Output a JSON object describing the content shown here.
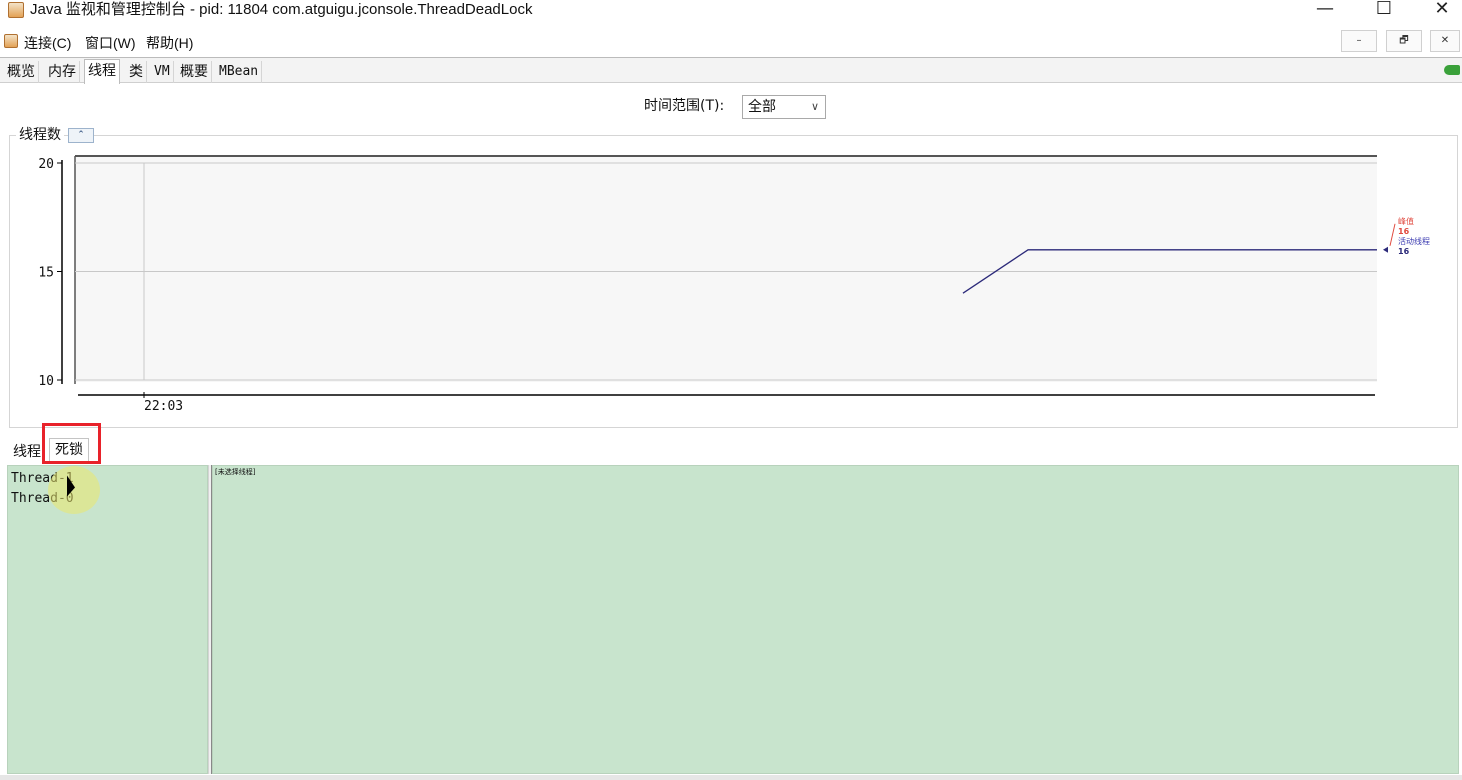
{
  "window": {
    "title": "Java 监视和管理控制台 - pid: 11804 com.atguigu.jconsole.ThreadDeadLock",
    "minimize_glyph": "—",
    "maximize_glyph": "☐",
    "close_glyph": "✕"
  },
  "menu": {
    "items": [
      "连接(C)",
      "窗口(W)",
      "帮助(H)"
    ],
    "inner_buttons": [
      "–",
      "🗗",
      "✕"
    ]
  },
  "main_tabs": {
    "items": [
      "概览",
      "内存",
      "线程",
      "类",
      "VM",
      "概要",
      "MBean"
    ],
    "active": "线程"
  },
  "time_range": {
    "label": "时间范围(T):",
    "value": "全部",
    "caret": "∨"
  },
  "panel": {
    "title": "线程数",
    "collapse_glyph": "⌃"
  },
  "chart_data": {
    "type": "line",
    "title": "",
    "xlabel": "",
    "ylabel": "",
    "ylim": [
      10,
      20
    ],
    "yticks": [
      10,
      15,
      20
    ],
    "xticks": [
      "22:03"
    ],
    "x_range": [
      0,
      100
    ],
    "x_tick_positions": [
      5.3
    ],
    "grid": true,
    "series": [
      {
        "name": "活动线程",
        "color": "#2c2a7a",
        "x": [
          68.2,
          73.2,
          100
        ],
        "y": [
          14,
          16,
          16
        ]
      }
    ],
    "legend": {
      "entries": [
        {
          "label": "峰值",
          "value": "16",
          "color": "#e04a3f"
        },
        {
          "label": "活动线程",
          "value": "16",
          "color": "#3a3ab0"
        }
      ],
      "placement": "right"
    }
  },
  "sub_tabs": {
    "items": [
      "线程",
      "死锁"
    ],
    "active": "死锁"
  },
  "threads": [
    "Thread-1",
    "Thread-0"
  ],
  "detail": {
    "text": "[未选择线程]"
  },
  "colors": {
    "pane_bg": "#c8e4cd",
    "highlight": "#e8222a",
    "series": "#2c2a7a"
  }
}
